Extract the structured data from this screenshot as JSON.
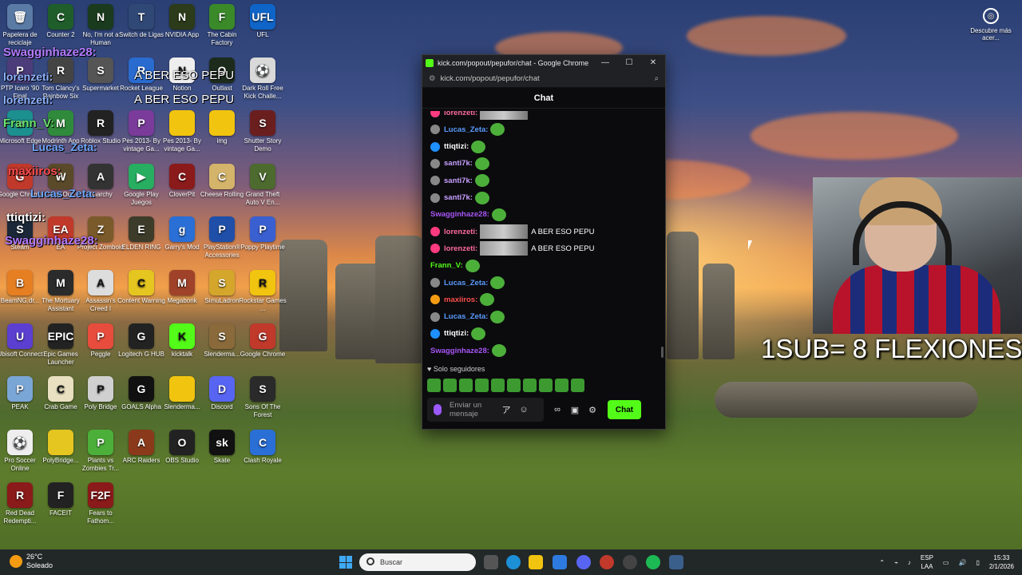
{
  "desktop": {
    "icons": [
      {
        "label": "Papelera de reciclaje",
        "color": "#5a7ba6",
        "glyph": "🗑"
      },
      {
        "label": "Counter 2",
        "color": "#1f5e2b",
        "glyph": "C"
      },
      {
        "label": "No, I'm not a Human",
        "color": "#1b3b1e",
        "glyph": "N"
      },
      {
        "label": "Switch de Ligas",
        "color": "#304876",
        "glyph": "T"
      },
      {
        "label": "NVIDIA App",
        "color": "#2c3b19",
        "glyph": "N"
      },
      {
        "label": "The Cabin Factory",
        "color": "#3a8a2a",
        "glyph": "F"
      },
      {
        "label": "UFL",
        "color": "#0f64c8",
        "glyph": "UFL"
      },
      {
        "label": "PTP Icaro '90 Final",
        "color": "#4d3c7a",
        "glyph": "P"
      },
      {
        "label": "Tom Clancy's Rainbow Six",
        "color": "#444",
        "glyph": "R"
      },
      {
        "label": "Supermarket",
        "color": "#555",
        "glyph": "S"
      },
      {
        "label": "Rocket League",
        "color": "#2a6bd0",
        "glyph": "R"
      },
      {
        "label": "Notion",
        "color": "#eeeeee",
        "glyph": "N"
      },
      {
        "label": "Outlast",
        "color": "#1c2b1c",
        "glyph": "O"
      },
      {
        "label": "Dark Roll Free Kick Challe...",
        "color": "#d9d9d9",
        "glyph": "⚽"
      },
      {
        "label": "Microsoft Edge",
        "color": "#1c8f8f",
        "glyph": "e"
      },
      {
        "label": "Modrinth App",
        "color": "#2f8a3c",
        "glyph": "M"
      },
      {
        "label": "Roblox Studio",
        "color": "#222",
        "glyph": "R"
      },
      {
        "label": "Pes 2013- By vintage Ga...",
        "color": "#7a3b9a",
        "glyph": "P"
      },
      {
        "label": "Pes 2013- By vintage Ga...",
        "color": "#f1c40f",
        "glyph": ""
      },
      {
        "label": "img",
        "color": "#f1c40f",
        "glyph": ""
      },
      {
        "label": "Shutter Story Demo",
        "color": "#6b1e1e",
        "glyph": "S"
      },
      {
        "label": "Google Chrome",
        "color": "#c0392b",
        "glyph": "G"
      },
      {
        "label": "Way Out",
        "color": "#5a4a2a",
        "glyph": "W"
      },
      {
        "label": "Anarchy",
        "color": "#333",
        "glyph": "A"
      },
      {
        "label": "Google Play Juegos",
        "color": "#27ae60",
        "glyph": "▶"
      },
      {
        "label": "CloverPit",
        "color": "#8b1a1a",
        "glyph": "C"
      },
      {
        "label": "Cheese Rolling",
        "color": "#d4b36a",
        "glyph": "C"
      },
      {
        "label": "Grand Theft Auto V En...",
        "color": "#4d6a2f",
        "glyph": "V"
      },
      {
        "label": "Steam",
        "color": "#1b2838",
        "glyph": "S"
      },
      {
        "label": "EA",
        "color": "#c0392b",
        "glyph": "EA"
      },
      {
        "label": "Project Zomboid",
        "color": "#7a5a2a",
        "glyph": "Z"
      },
      {
        "label": "ELDEN RING",
        "color": "#3d3b2a",
        "glyph": "E"
      },
      {
        "label": "Garry's Mod",
        "color": "#2a6fd6",
        "glyph": "g"
      },
      {
        "label": "PlayStation® Accessories",
        "color": "#1f4fa8",
        "glyph": "P"
      },
      {
        "label": "Poppy Playtime",
        "color": "#3a5fd0",
        "glyph": "P"
      },
      {
        "label": "BeamNG.dr...",
        "color": "#e67e22",
        "glyph": "B"
      },
      {
        "label": "The Mortuary Assistant",
        "color": "#2b2b2b",
        "glyph": "M"
      },
      {
        "label": "Assassin's Creed I",
        "color": "#dddddd",
        "glyph": "A"
      },
      {
        "label": "Content Warning",
        "color": "#e5c520",
        "glyph": "C"
      },
      {
        "label": "Megabonk",
        "color": "#a0422a",
        "glyph": "M"
      },
      {
        "label": "SimuLadron",
        "color": "#d4a72c",
        "glyph": "S"
      },
      {
        "label": "Rockstar Games ...",
        "color": "#f1c40f",
        "glyph": "R"
      },
      {
        "label": "Ubisoft Connect",
        "color": "#5b3fd0",
        "glyph": "U"
      },
      {
        "label": "Epic Games Launcher",
        "color": "#222",
        "glyph": "EPIC"
      },
      {
        "label": "Peggle",
        "color": "#e74c3c",
        "glyph": "P"
      },
      {
        "label": "Logitech G HUB",
        "color": "#222",
        "glyph": "G"
      },
      {
        "label": "kicktalk",
        "color": "#53fc18",
        "glyph": "K"
      },
      {
        "label": "Slenderma...",
        "color": "#8a6a3a",
        "glyph": "S"
      },
      {
        "label": "Google Chrome",
        "color": "#c0392b",
        "glyph": "G"
      },
      {
        "label": "PEAK",
        "color": "#7aa6d6",
        "glyph": "P"
      },
      {
        "label": "Crab Game",
        "color": "#e8e0c0",
        "glyph": "C"
      },
      {
        "label": "Poly Bridge",
        "color": "#d0d0d0",
        "glyph": "P"
      },
      {
        "label": "GOALS Alpha",
        "color": "#111",
        "glyph": "G"
      },
      {
        "label": "Slenderma...",
        "color": "#f1c40f",
        "glyph": ""
      },
      {
        "label": "Discord",
        "color": "#5865f2",
        "glyph": "D"
      },
      {
        "label": "Sons Of The Forest",
        "color": "#2a2a2a",
        "glyph": "S"
      },
      {
        "label": "Pro Soccer Online",
        "color": "#eeeeee",
        "glyph": "⚽"
      },
      {
        "label": "PolyBridge...",
        "color": "#e5c520",
        "glyph": ""
      },
      {
        "label": "Plants vs Zombies Tr...",
        "color": "#4caf3a",
        "glyph": "P"
      },
      {
        "label": "ARC Raiders",
        "color": "#8a3a1a",
        "glyph": "A"
      },
      {
        "label": "OBS Studio",
        "color": "#222",
        "glyph": "O"
      },
      {
        "label": "Skate",
        "color": "#111",
        "glyph": "sk"
      },
      {
        "label": "Clash Royale",
        "color": "#2a6fd6",
        "glyph": "C"
      },
      {
        "label": "Red Dead Redempti...",
        "color": "#8b1a1a",
        "glyph": "R"
      },
      {
        "label": "FACEIT",
        "color": "#222",
        "glyph": "F"
      },
      {
        "label": "Fears to Fathom...",
        "color": "#8b1a1a",
        "glyph": "F2F"
      }
    ],
    "overlay_names": [
      {
        "text": "Swagginhaze28:",
        "color": "#b57bff"
      },
      {
        "text": "lorenzeti:",
        "color": "#8fb4ff"
      },
      {
        "text": "lorenzeti:",
        "color": "#8fb4ff"
      },
      {
        "text": "Frann_V:",
        "color": "#6be36b"
      },
      {
        "text": "Lucas_Zeta:",
        "color": "#6fa8ff"
      },
      {
        "text": "maxiiros:",
        "color": "#ff4d4d"
      },
      {
        "text": "Lucas_Zeta:",
        "color": "#6fa8ff"
      },
      {
        "text": "ttiqtizi:",
        "color": "#ffffff"
      },
      {
        "text": "Swagginhaze28:",
        "color": "#b57bff"
      }
    ],
    "overlay_msgs": [
      "A BER ESO PEPU",
      "A BER ESO PEPU"
    ],
    "discover": "Descubre más acer..."
  },
  "popup": {
    "title": "kick.com/popout/pepufor/chat - Google Chrome",
    "url": "kick.com/popout/pepufor/chat",
    "header": "Chat",
    "messages": [
      {
        "user": "lorenzeti:",
        "color": "#ff6b9d",
        "badge": "#ff3b7f",
        "kind": "pic",
        "text": ""
      },
      {
        "user": "Lucas_Zeta:",
        "color": "#5a9bff",
        "badge": "#888",
        "kind": "emote",
        "text": ""
      },
      {
        "user": "ttiqtizi:",
        "color": "#ffffff",
        "badge": "#1e90ff",
        "kind": "emote",
        "text": ""
      },
      {
        "user": "santi7k:",
        "color": "#c8a0ff",
        "badge": "#888",
        "kind": "emote",
        "text": ""
      },
      {
        "user": "santi7k:",
        "color": "#c8a0ff",
        "badge": "#888",
        "kind": "emote",
        "text": ""
      },
      {
        "user": "santi7k:",
        "color": "#c8a0ff",
        "badge": "#888",
        "kind": "emote",
        "text": ""
      },
      {
        "user": "Swagginhaze28:",
        "color": "#a855f7",
        "badge": "",
        "kind": "emote",
        "text": ""
      },
      {
        "user": "lorenzeti:",
        "color": "#ff6b9d",
        "badge": "#ff3b7f",
        "kind": "pic",
        "text": "A BER ESO PEPU"
      },
      {
        "user": "lorenzeti:",
        "color": "#ff6b9d",
        "badge": "#ff3b7f",
        "kind": "pic",
        "text": "A BER ESO PEPU"
      },
      {
        "user": "Frann_V:",
        "color": "#53fc18",
        "badge": "",
        "kind": "emote",
        "text": ""
      },
      {
        "user": "Lucas_Zeta:",
        "color": "#5a9bff",
        "badge": "#888",
        "kind": "emote",
        "text": ""
      },
      {
        "user": "maxiiros:",
        "color": "#ff4d4d",
        "badge": "#f39c12",
        "kind": "emote",
        "text": ""
      },
      {
        "user": "Lucas_Zeta:",
        "color": "#5a9bff",
        "badge": "#888",
        "kind": "emote",
        "text": ""
      },
      {
        "user": "ttiqtizi:",
        "color": "#ffffff",
        "badge": "#1e90ff",
        "kind": "emote",
        "text": ""
      },
      {
        "user": "Swagginhaze28:",
        "color": "#a855f7",
        "badge": "",
        "kind": "emote",
        "text": ""
      }
    ],
    "mode": "Solo seguidores",
    "input_placeholder": "Enviar un mensaje",
    "send_label": "Chat"
  },
  "stream_overlay": "1SUB= 8 FLEXIONES",
  "taskbar": {
    "temp": "26°C",
    "weather": "Soleado",
    "search_placeholder": "Buscar",
    "lang_top": "ESP",
    "lang_bottom": "LAA",
    "time": "15:33",
    "date": "2/1/2026"
  }
}
